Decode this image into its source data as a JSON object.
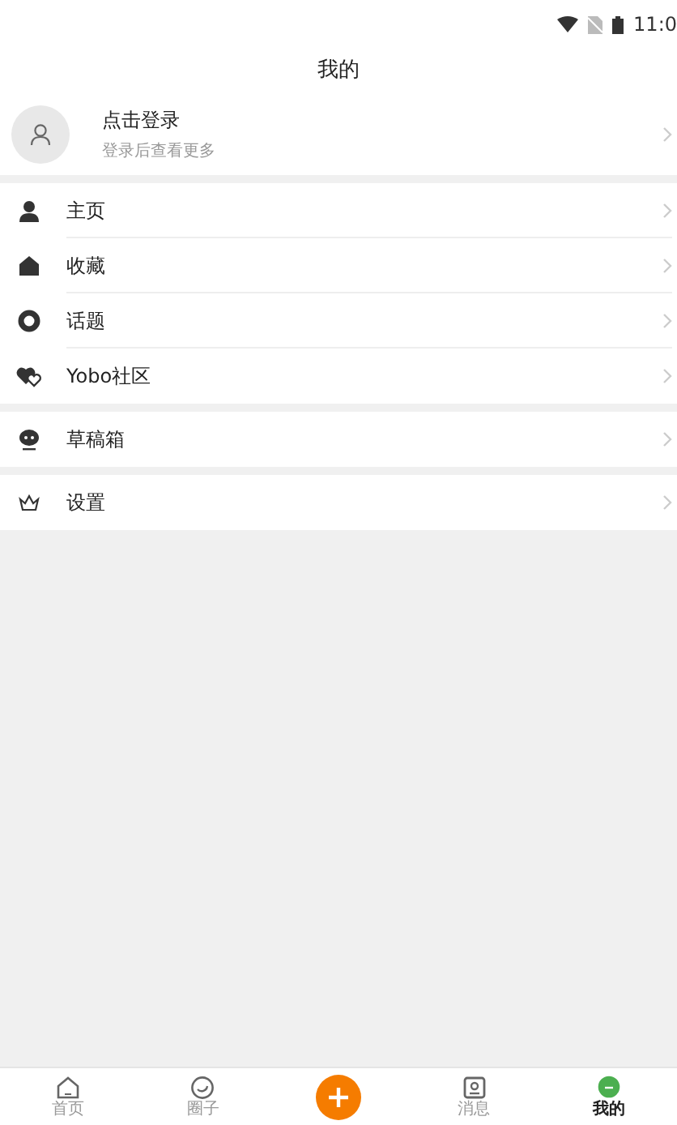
{
  "status_bar": {
    "time": "11:0"
  },
  "title": "我的",
  "profile": {
    "name": "点击登录",
    "hint": "登录后查看更多"
  },
  "menu_groups": [
    {
      "items": [
        {
          "kind": "person",
          "label": "主页"
        },
        {
          "kind": "home",
          "label": "收藏"
        },
        {
          "kind": "ring",
          "label": "话题"
        },
        {
          "kind": "hearts",
          "label": "Yobo社区"
        }
      ]
    },
    {
      "items": [
        {
          "kind": "chat",
          "label": "草稿箱"
        }
      ]
    },
    {
      "items": [
        {
          "kind": "crown",
          "label": "设置"
        }
      ]
    }
  ],
  "tab_bar": [
    {
      "kind": "home",
      "label": "首页",
      "selected": false
    },
    {
      "kind": "circle",
      "label": "圈子",
      "selected": false
    },
    {
      "kind": "plus"
    },
    {
      "kind": "message",
      "label": "消息",
      "selected": false
    },
    {
      "kind": "me",
      "label": "我的",
      "selected": true
    }
  ]
}
